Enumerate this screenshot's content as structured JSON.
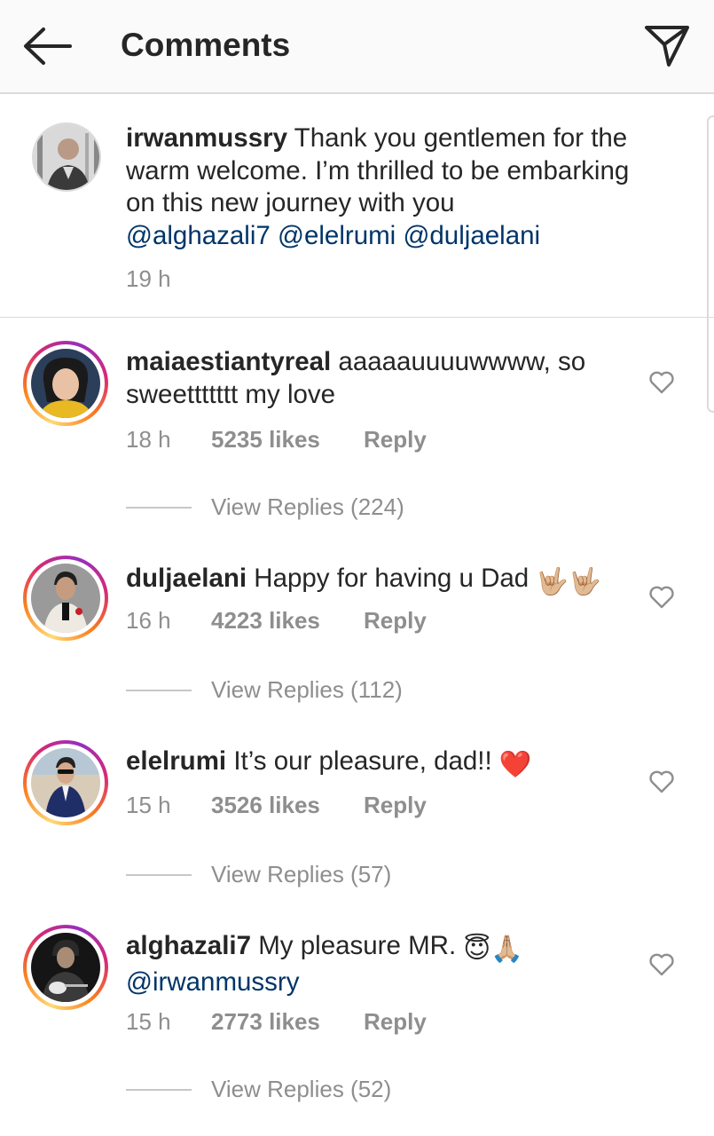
{
  "header": {
    "title": "Comments",
    "back_icon": "arrow-left-icon",
    "share_icon": "send-icon"
  },
  "caption": {
    "username": "irwanmussry",
    "text": "Thank you gentlemen for the warm welcome. I’m thrilled to be embarking on this new journey with you",
    "mentions": [
      "@alghazali7",
      "@elelrumi",
      "@duljaelani"
    ],
    "time": "19 h"
  },
  "comments": [
    {
      "username": "maiaestiantyreal",
      "text": "aaaaauuuuwwww, so sweettttttt my love",
      "time": "18 h",
      "likes": "5235 likes",
      "reply": "Reply",
      "view_replies": "View Replies (224)"
    },
    {
      "username": "duljaelani",
      "text": "Happy for having u Dad",
      "emoji": "🤟🏼🤟🏼",
      "time": "16 h",
      "likes": "4223 likes",
      "reply": "Reply",
      "view_replies": "View Replies (112)"
    },
    {
      "username": "elelrumi",
      "text": "It’s our pleasure, dad!!",
      "emoji": "❤️",
      "time": "15 h",
      "likes": "3526 likes",
      "reply": "Reply",
      "view_replies": "View Replies (57)"
    },
    {
      "username": "alghazali7",
      "text": "My pleasure MR.",
      "emoji": "😇🙏🏼",
      "mention": "@irwanmussry",
      "time": "15 h",
      "likes": "2773 likes",
      "reply": "Reply",
      "view_replies": "View Replies (52)"
    }
  ],
  "colors": {
    "mention": "#003569",
    "meta": "#8e8e8e",
    "text": "#262626",
    "header_bg": "#fafafa"
  }
}
